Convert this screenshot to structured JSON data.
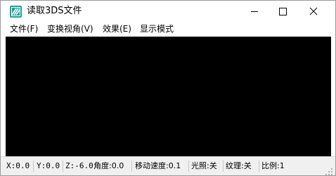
{
  "window": {
    "title": "读取3DS文件",
    "app_icon": "app-logo-icon"
  },
  "caption_buttons": {
    "minimize": "minimize-icon",
    "maximize": "maximize-icon",
    "close": "close-icon"
  },
  "menu": {
    "file": "文件(F)",
    "view": "变换视角(V)",
    "effect": "效果(E)",
    "display": "显示模式"
  },
  "status": {
    "x": "X:0.0",
    "y": "Y:0.0",
    "z": "Z:-6.0",
    "angle": "角度:0.0",
    "speed": "移动速度:0.1",
    "light": "光照:关",
    "texture": "纹理:关",
    "scale": "比例:1"
  },
  "colors": {
    "viewport_bg": "#000000",
    "statusbar_bg": "#f0f0f0",
    "icon_teal": "#1aa39a"
  }
}
